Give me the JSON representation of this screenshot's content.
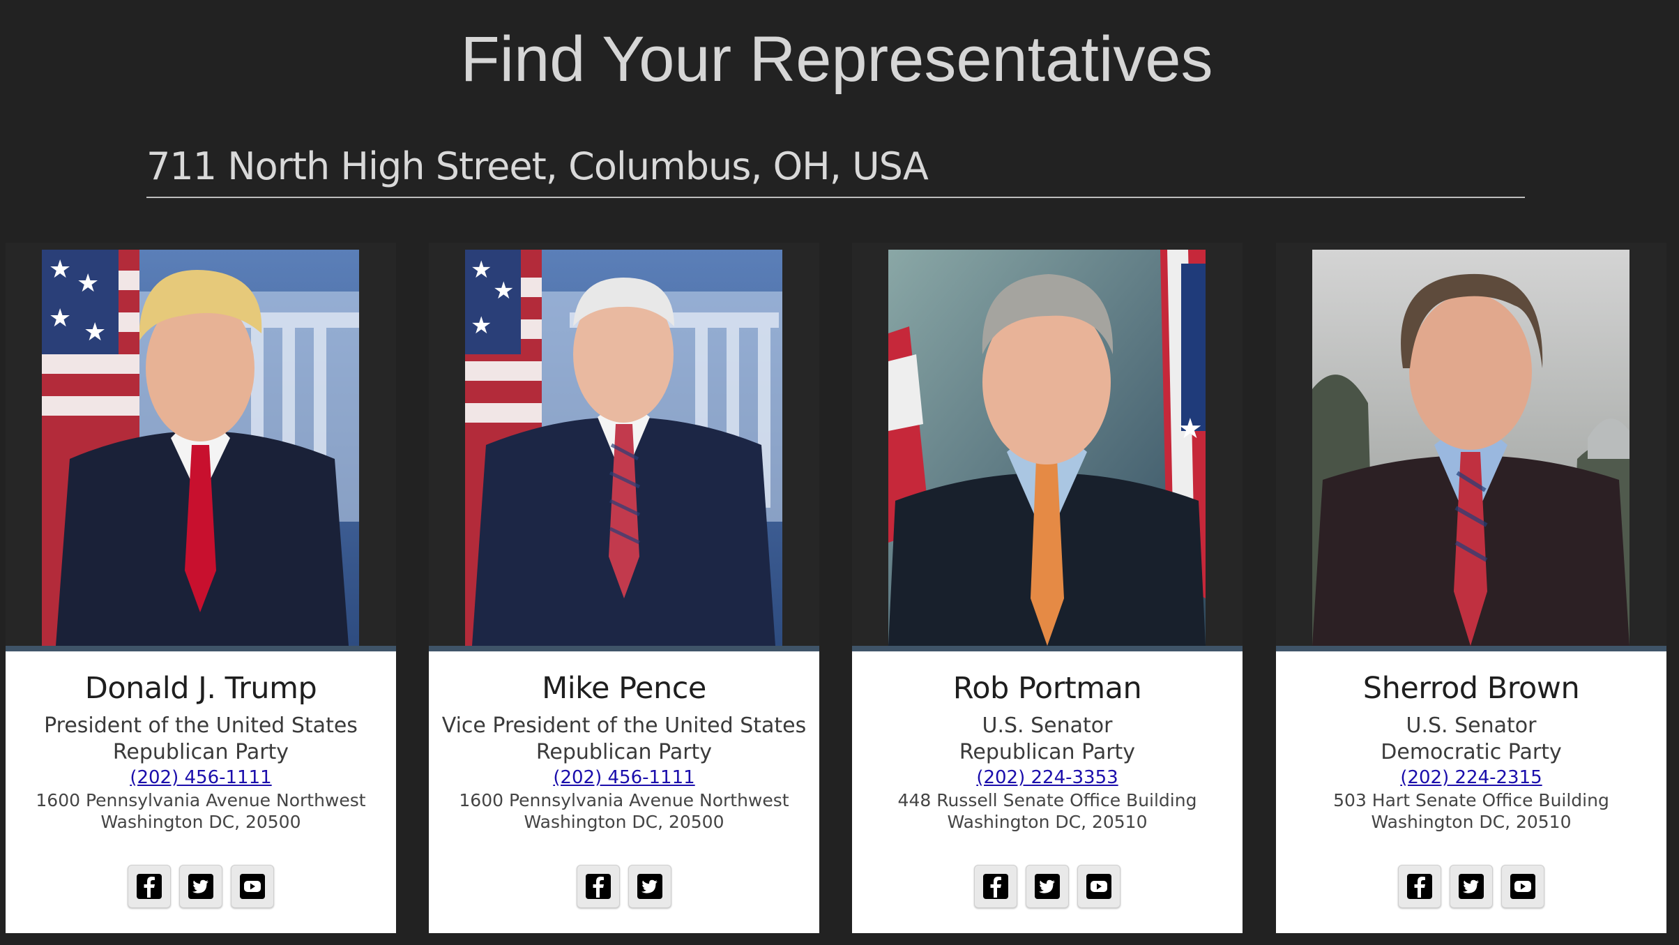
{
  "page": {
    "title": "Find Your Representatives"
  },
  "search": {
    "address_value": "711 North High Street, Columbus, OH, USA"
  },
  "representatives": [
    {
      "name": "Donald J. Trump",
      "office": "President of the United States",
      "party": "Republican Party",
      "phone": "(202) 456-1111",
      "address_line1": "1600 Pennsylvania Avenue Northwest",
      "address_line2": "Washington DC, 20500",
      "social": [
        "facebook-icon",
        "twitter-icon",
        "youtube-icon"
      ]
    },
    {
      "name": "Mike Pence",
      "office": "Vice President of the United States",
      "party": "Republican Party",
      "phone": "(202) 456-1111",
      "address_line1": "1600 Pennsylvania Avenue Northwest",
      "address_line2": "Washington DC, 20500",
      "social": [
        "facebook-icon",
        "twitter-icon"
      ]
    },
    {
      "name": "Rob Portman",
      "office": "U.S. Senator",
      "party": "Republican Party",
      "phone": "(202) 224-3353",
      "address_line1": "448 Russell Senate Office Building",
      "address_line2": "Washington DC, 20510",
      "social": [
        "facebook-icon",
        "twitter-icon",
        "youtube-icon"
      ]
    },
    {
      "name": "Sherrod Brown",
      "office": "U.S. Senator",
      "party": "Democratic Party",
      "phone": "(202) 224-2315",
      "address_line1": "503 Hart Senate Office Building",
      "address_line2": "Washington DC, 20510",
      "social": [
        "facebook-icon",
        "twitter-icon",
        "youtube-icon"
      ]
    }
  ],
  "colors": {
    "background": "#222222",
    "card_border_accent": "#3f5468",
    "link": "#1a0dab"
  }
}
